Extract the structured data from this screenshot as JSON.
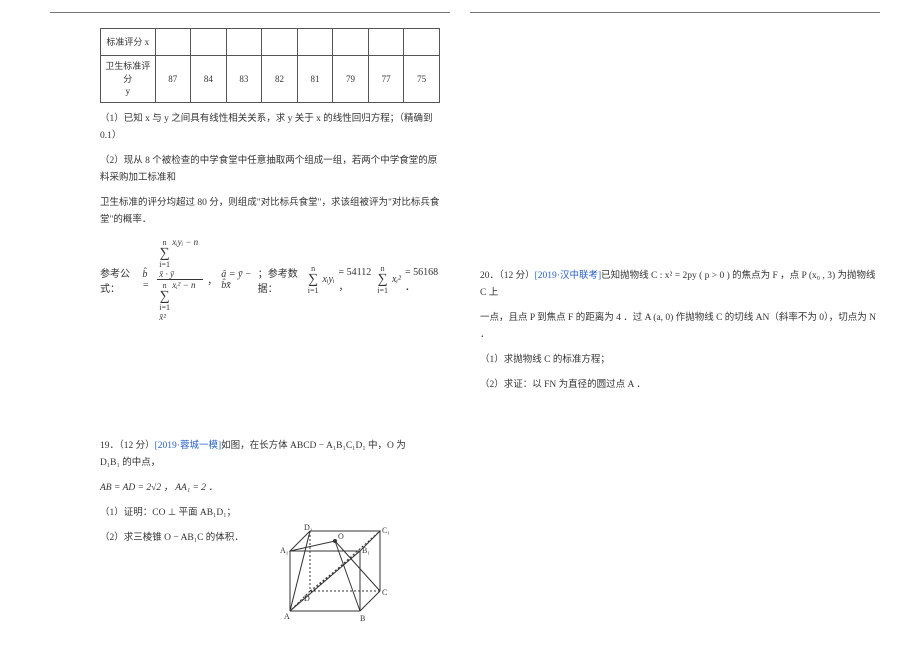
{
  "table": {
    "row1_label": "标准评分 x",
    "row2_label": "卫生标准评分\ny",
    "row2": [
      "87",
      "84",
      "83",
      "82",
      "81",
      "79",
      "77",
      "75"
    ]
  },
  "q18": {
    "p1": "（1）已知 x 与 y 之间具有线性相关关系，求 y 关于 x 的线性回归方程；（精确到 0.1）",
    "p2": "（2）现从 8 个被检查的中学食堂中任意抽取两个组成一组，若两个中学食堂的原料采购加工标准和",
    "p3": "卫生标准的评分均超过 80 分，则组成\"对比标兵食堂\"，求该组被评为\"对比标兵食堂\"的概率．",
    "p4_prefix": "参考公式：",
    "p4_mid": "，",
    "p4_mid2": "；参考数据：",
    "p4_eq1": " = 54112 ，",
    "p4_eq2": " = 56168 ．"
  },
  "q19": {
    "header_a": "19．（12 分）",
    "header_b": "[2019·蓉城一模]",
    "header_c": "如图，在长方体 ABCD − A₁B₁C₁D₁ 中，O 为 D₁B₁ 的中点，",
    "line2": "AB = AD = 2√2 ，  AA₁ = 2 ．",
    "line3": "（1）证明：CO ⊥ 平面 AB₁D₁；",
    "line4": "（2）求三棱锥 O − AB₁C 的体积．"
  },
  "q20": {
    "header_a": "20．（12 分）",
    "header_b": "[2019·汉中联考]",
    "header_c": "已知抛物线 C : x² = 2py ( p > 0 ) 的焦点为 F ，点 P (x₀ , 3) 为抛物线 C 上",
    "line2": "一点，且点 P 到焦点 F 的距离为 4 ．过 A (a, 0) 作抛物线 C 的切线 AN（斜率不为 0），切点为 N ．",
    "line3": "（1）求抛物线 C 的标准方程；",
    "line4": "（2）求证：以 FN 为直径的圆过点 A ．"
  },
  "diagram_labels": {
    "A1": "A₁",
    "B1": "B₁",
    "C1": "C₁",
    "D1": "D₁",
    "A": "A",
    "B": "B",
    "C": "C",
    "D": "D",
    "O": "O"
  }
}
